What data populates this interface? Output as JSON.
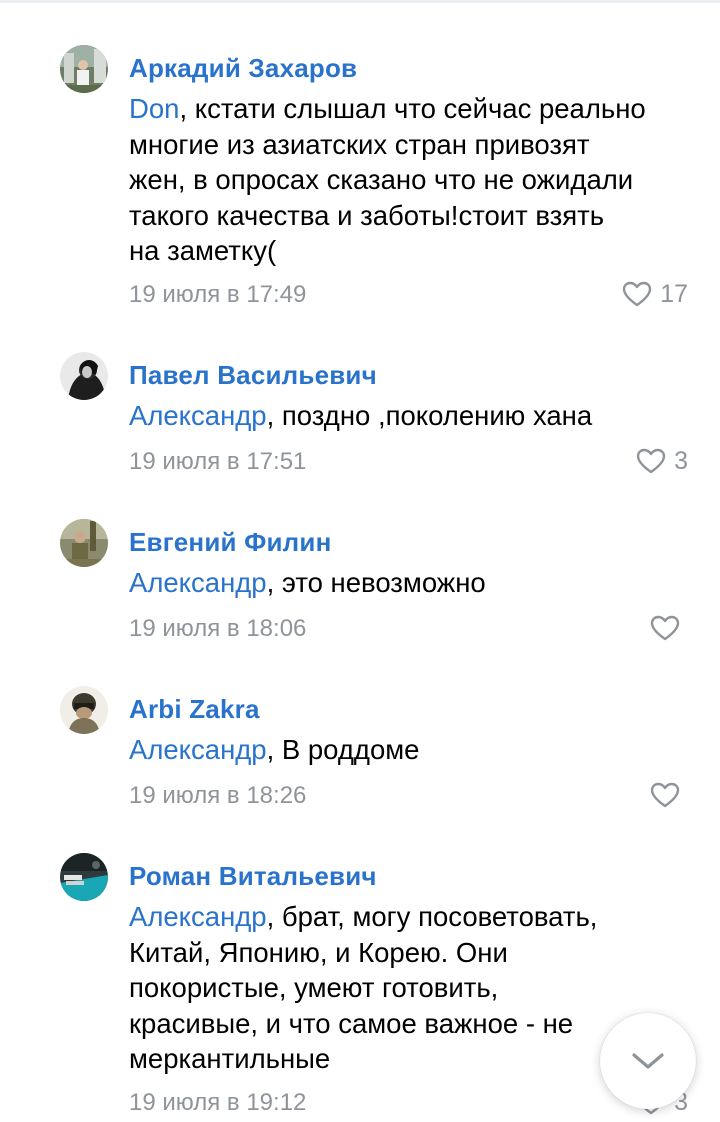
{
  "comments": [
    {
      "author": "Аркадий Захаров",
      "mention": "Don",
      "text_lines": [
        ", кстати слышал что сейчас реально",
        "многие из азиатских стран привозят",
        "жен, в опросах сказано что не ожидали",
        "такого качества и заботы!стоит взять",
        "на заметку("
      ],
      "date": "19 июля в 17:49",
      "likes": "17",
      "avatar_icon": "user-photo-icon"
    },
    {
      "author": "Павел Васильевич",
      "mention": "Александр",
      "text_lines": [
        ", поздно ,поколению хана"
      ],
      "date": "19 июля в 17:51",
      "likes": "3",
      "avatar_icon": "user-photo-icon"
    },
    {
      "author": "Евгений Филин",
      "mention": "Александр",
      "text_lines": [
        ", это невозможно"
      ],
      "date": "19 июля в 18:06",
      "likes": "",
      "avatar_icon": "user-photo-icon"
    },
    {
      "author": "Arbi Zakra",
      "mention": "Александр",
      "text_lines": [
        ", В роддоме"
      ],
      "date": "19 июля в 18:26",
      "likes": "",
      "avatar_icon": "user-photo-icon"
    },
    {
      "author": "Роман Витальевич",
      "mention": "Александр",
      "text_lines": [
        ", брат, могу посоветовать,",
        "Китай, Японию, и Корею. Они",
        "покористые, умеют готовить,",
        "красивые, и что самое важное - не",
        "меркантильные"
      ],
      "date": "19 июля в 19:12",
      "likes": "3",
      "avatar_icon": "user-photo-icon"
    }
  ],
  "icons": {
    "like": "heart-outline-icon",
    "scroll": "chevron-down-icon"
  },
  "colors": {
    "link": "#2a73cc",
    "meta": "#8f949a",
    "text": "#000000"
  }
}
